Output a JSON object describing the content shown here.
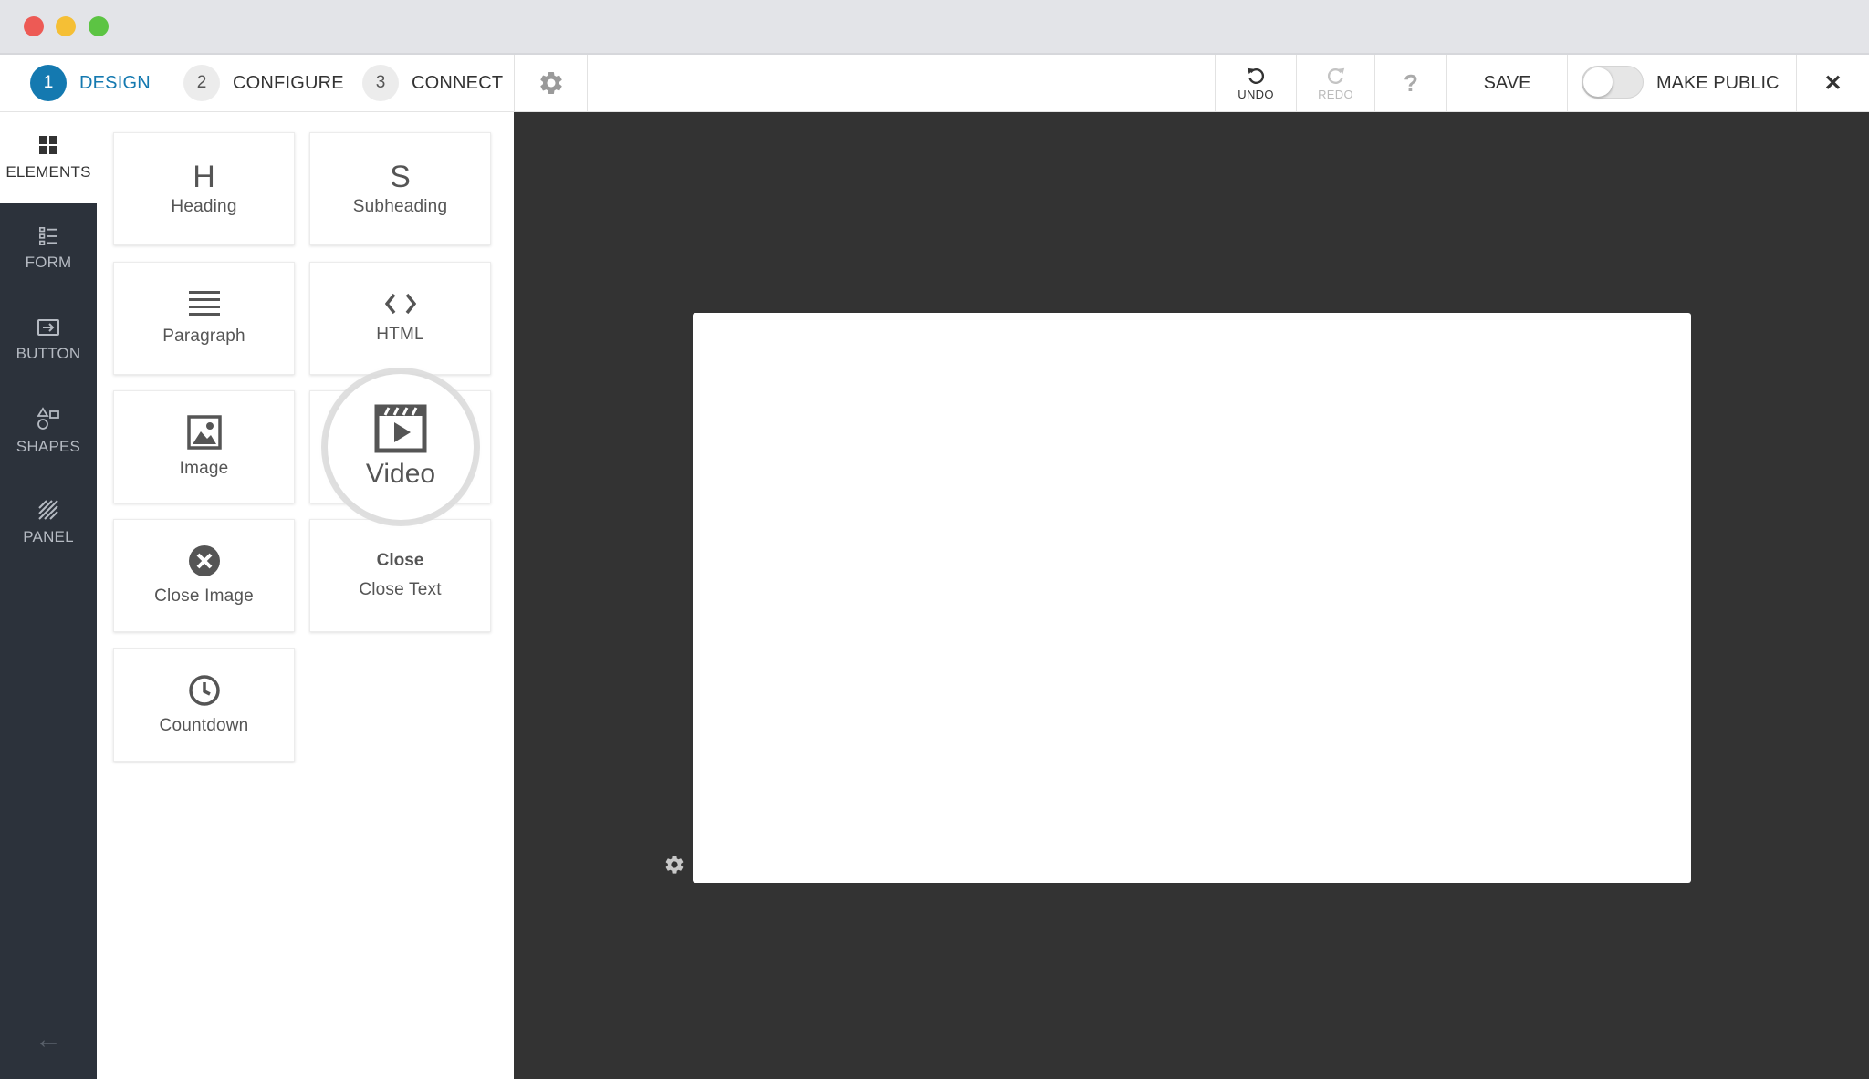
{
  "window": {
    "controls": [
      "close",
      "minimize",
      "maximize"
    ]
  },
  "toolbar": {
    "steps": [
      {
        "num": "1",
        "label": "DESIGN",
        "active": true
      },
      {
        "num": "2",
        "label": "CONFIGURE",
        "active": false
      },
      {
        "num": "3",
        "label": "CONNECT",
        "active": false
      }
    ],
    "settings_icon": "gear-icon",
    "undo_label": "UNDO",
    "redo_label": "REDO",
    "help_icon": "?",
    "save_label": "SAVE",
    "make_public_label": "MAKE PUBLIC",
    "make_public_on": false,
    "close_icon": "✕"
  },
  "sidebar": {
    "items": [
      {
        "label": "ELEMENTS",
        "icon": "grid-icon",
        "active": true
      },
      {
        "label": "FORM",
        "icon": "form-icon",
        "active": false
      },
      {
        "label": "BUTTON",
        "icon": "button-icon",
        "active": false
      },
      {
        "label": "SHAPES",
        "icon": "shapes-icon",
        "active": false
      },
      {
        "label": "PANEL",
        "icon": "panel-icon",
        "active": false
      }
    ],
    "back_icon": "←"
  },
  "elements": {
    "heading": {
      "glyph": "H",
      "label": "Heading"
    },
    "subheading": {
      "glyph": "S",
      "label": "Subheading"
    },
    "paragraph": {
      "label": "Paragraph"
    },
    "html": {
      "glyph": "<>",
      "label": "HTML"
    },
    "image": {
      "label": "Image"
    },
    "video": {
      "label": "Video"
    },
    "close_image": {
      "label": "Close Image"
    },
    "close_text": {
      "glyph": "Close",
      "label": "Close Text"
    },
    "countdown": {
      "label": "Countdown"
    }
  },
  "colors": {
    "accent": "#1479b0",
    "nav_bg": "#2c323b",
    "canvas_bg": "#333333"
  }
}
